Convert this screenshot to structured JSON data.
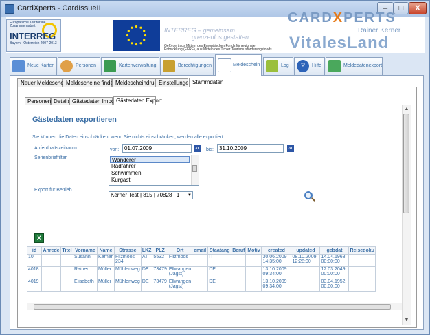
{
  "window": {
    "title": "CardXperts - CardIssueII",
    "min": "–",
    "max": "□",
    "close": "X"
  },
  "banner": {
    "interreg_top": "Europäische Territoriale Zusammenarbeit",
    "interreg_name": "INTERREG",
    "interreg_sub": "Bayern - Österreich 2007-2013",
    "slogan_line1": "INTERREG – gemeinsam",
    "slogan_line2": "grenzenlos gestalten",
    "funding_line1": "Gefördert aus Mitteln des Europäischen Fonds für regionale",
    "funding_line2": "Entwicklung (EFRE), aus Mitteln des Tiroler Tourismusförderungsfonds",
    "cardx_pre": "CARD",
    "cardx_x": "X",
    "cardx_post": "PERTS",
    "rainer": "Rainer Kerner",
    "vitales": "VitalesLand"
  },
  "main_tabs": [
    {
      "label": "Neue Karten",
      "icon": "new-card-icon",
      "color": "#5b8fd6"
    },
    {
      "label": "Personen",
      "icon": "person-icon",
      "color": "#e0a048"
    },
    {
      "label": "Kartenverwaltung",
      "icon": "card-management-icon",
      "color": "#3b9b52"
    },
    {
      "label": "Berechtigungen",
      "icon": "keys-icon",
      "color": "#c8a030"
    },
    {
      "label": "Meldeschein",
      "icon": "form-icon",
      "color": "#8da3c1"
    },
    {
      "label": "Log",
      "icon": "log-icon",
      "color": "#9bbf3c"
    },
    {
      "label": "Hilfe",
      "icon": "help-icon",
      "color": "#2d63b8"
    },
    {
      "label": "Meldedatenexport",
      "icon": "export-icon",
      "color": "#4aa85c"
    }
  ],
  "sub_tabs": [
    "Neuer Meldeschein",
    "Meldescheine finden",
    "Meldescheindruck",
    "Einstellungen",
    "Stammdaten"
  ],
  "inner_tabs": [
    "Personen",
    "Details",
    "Gästedaten Import",
    "Gästedaten Export"
  ],
  "form": {
    "heading": "Gästedaten exportieren",
    "info": "Sie können die Daten einschränken, wenn Sie nichts einschränken, werden alle exportiert.",
    "period_label": "Aufenthaltszeitraum:",
    "from_label": "von:",
    "from_value": "01.07.2009",
    "to_label": "bis:",
    "to_value": "31.10.2009",
    "cal_label": "31",
    "serial_label": "Serienbrieffilter",
    "serial_options": [
      "Wanderer",
      "Radfahrer",
      "Schwimmen",
      "Kurgast"
    ],
    "export_label": "Export für Betrieb",
    "export_value": "Kerner Test | 815 | 70828 | 1"
  },
  "grid": {
    "columns": [
      "id",
      "Anrede",
      "Titel",
      "Vorname",
      "Name",
      "Strasse",
      "LKZ",
      "PLZ",
      "Ort",
      "email",
      "Staatang",
      "Beruf",
      "Motiv",
      "created",
      "updated",
      "gebdat",
      "Reisedoku"
    ],
    "rows": [
      [
        "10",
        "",
        "",
        "Susann",
        "Kerner",
        "Filzmoos 234",
        "AT",
        "5532",
        "Filzmoos",
        "",
        "IT",
        "",
        "",
        "30.06.2009 14:35:00",
        "08.10.2009 12:28:00",
        "14.04.1968 00:00:00",
        ""
      ],
      [
        "4018",
        "",
        "",
        "Rainer",
        "Müller",
        "Mühlenweg",
        "DE",
        "73479",
        "Ellwangen (Jagst)",
        "",
        "DE",
        "",
        "",
        "13.10.2009 09:34:00",
        "",
        "12.03.2049 00:00:00",
        ""
      ],
      [
        "4019",
        "",
        "",
        "Elisabeth",
        "Müller",
        "Mühlenweg",
        "DE",
        "73479",
        "Ellwangen (Jagst)",
        "",
        "DE",
        "",
        "",
        "13.10.2009 09:34:00",
        "",
        "03.04.1952 00:00:00",
        ""
      ]
    ]
  }
}
